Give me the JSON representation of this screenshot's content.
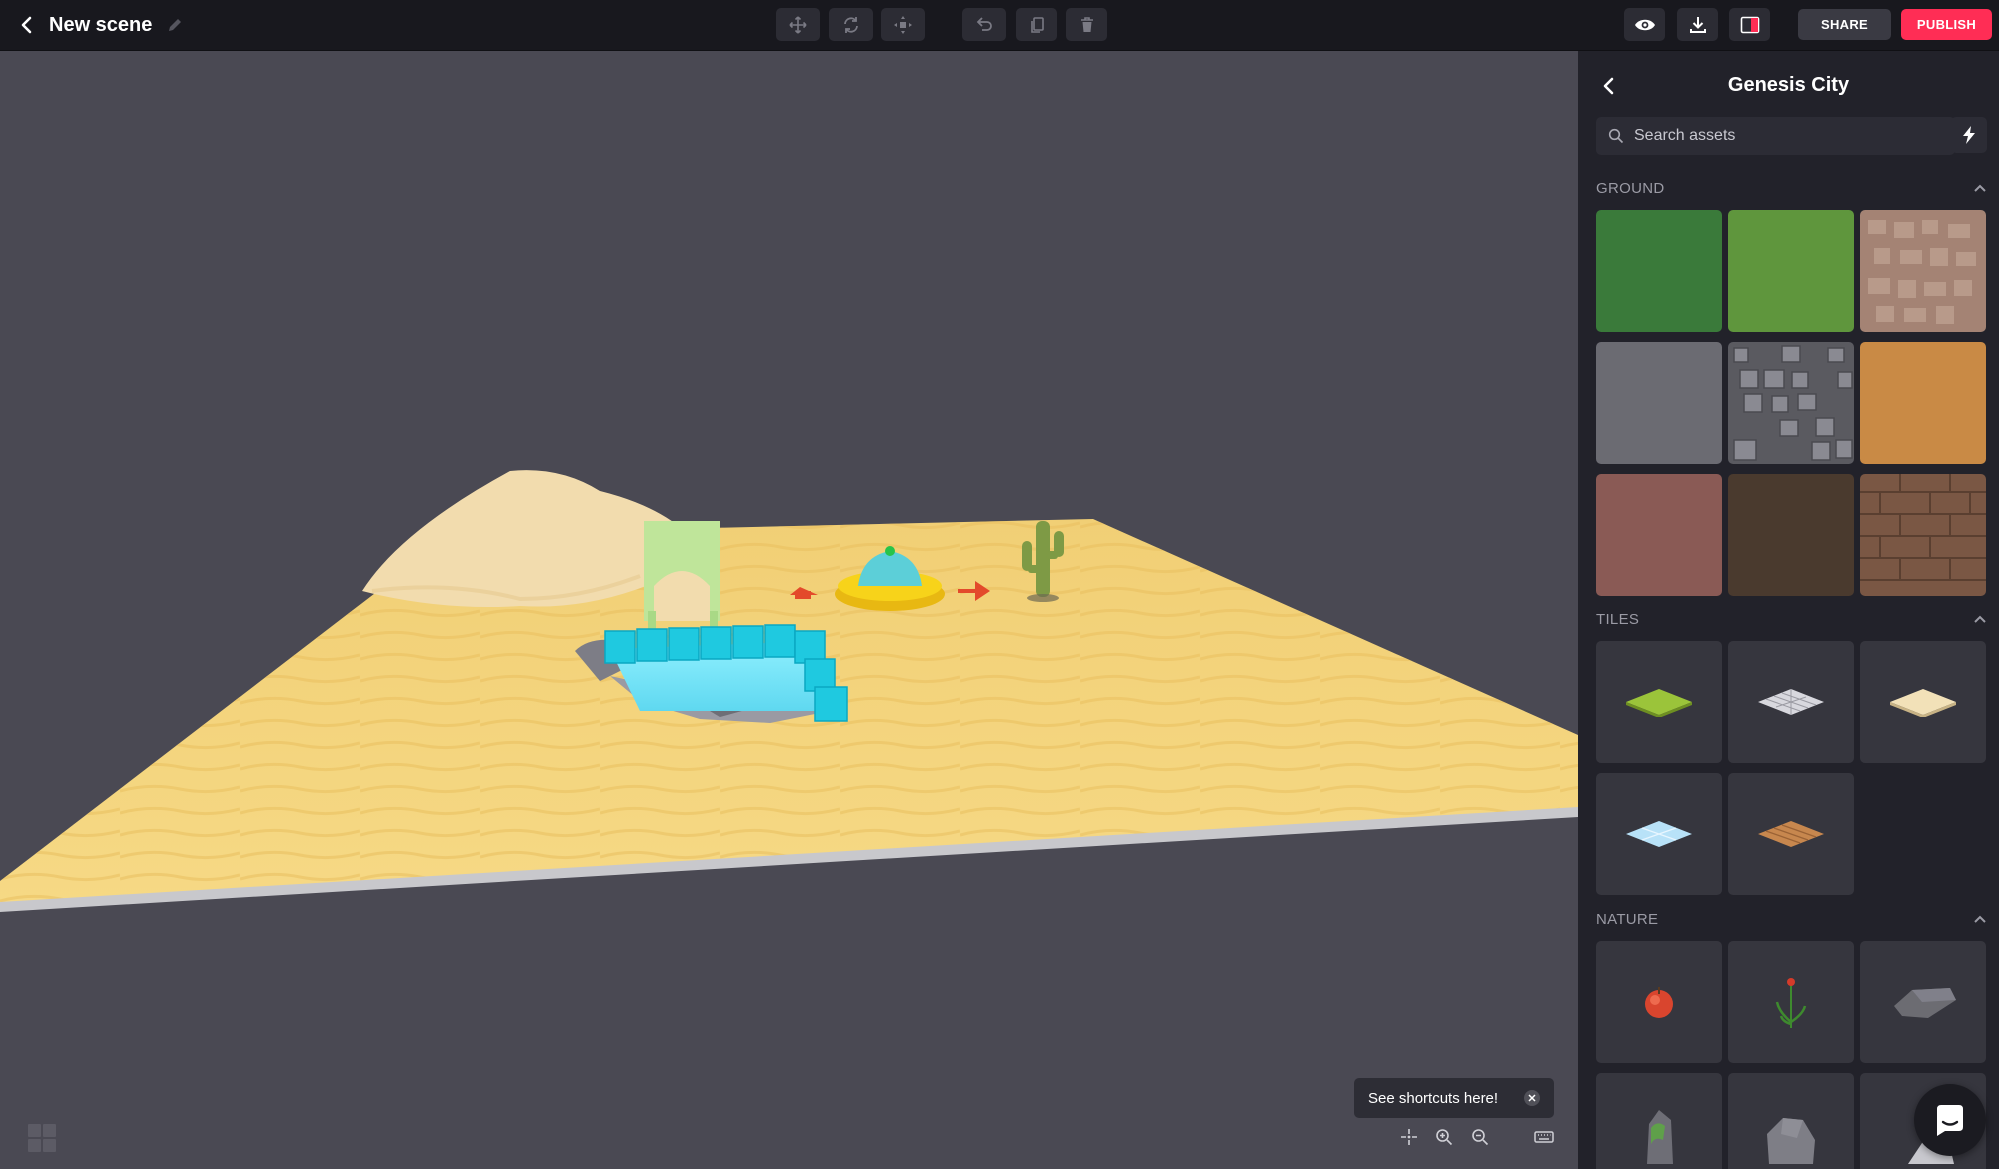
{
  "header": {
    "scene_title": "New scene",
    "share_label": "SHARE",
    "publish_label": "PUBLISH"
  },
  "toolbar": {
    "tools": [
      "move-icon",
      "rotate-icon",
      "scale-icon",
      "undo-icon",
      "duplicate-icon",
      "delete-icon"
    ],
    "right_tools": [
      "preview-icon",
      "download-icon",
      "layout-icon"
    ]
  },
  "viewport": {
    "toast_text": "See shortcuts here!"
  },
  "sidebar": {
    "title": "Genesis City",
    "search_placeholder": "Search assets",
    "sections": [
      {
        "label": "GROUND"
      },
      {
        "label": "TILES"
      },
      {
        "label": "NATURE"
      }
    ]
  },
  "colors": {
    "accent": "#ff2d55",
    "topbar": "#18181e",
    "viewport": "#4a4953",
    "sidebar": "#22222a",
    "sand": "#f4d27a"
  }
}
